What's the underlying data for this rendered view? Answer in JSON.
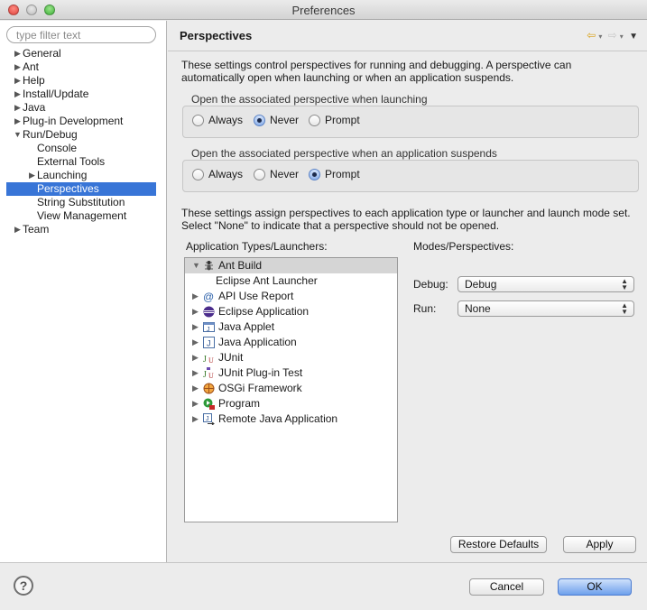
{
  "window": {
    "title": "Preferences"
  },
  "filter": {
    "placeholder": "type filter text"
  },
  "tree": {
    "items": [
      {
        "label": "General"
      },
      {
        "label": "Ant"
      },
      {
        "label": "Help"
      },
      {
        "label": "Install/Update"
      },
      {
        "label": "Java"
      },
      {
        "label": "Plug-in Development"
      },
      {
        "label": "Run/Debug"
      },
      {
        "label": "Console"
      },
      {
        "label": "External Tools"
      },
      {
        "label": "Launching"
      },
      {
        "label": "Perspectives"
      },
      {
        "label": "String Substitution"
      },
      {
        "label": "View Management"
      },
      {
        "label": "Team"
      }
    ]
  },
  "page": {
    "title": "Perspectives",
    "description_line1": "These settings control perspectives for running and debugging. A perspective can",
    "description_line2": "automatically open when launching or when an application suspends.",
    "launch_group": {
      "label": "Open the associated perspective when launching",
      "options": [
        "Always",
        "Never",
        "Prompt"
      ],
      "selected": "Never"
    },
    "suspend_group": {
      "label": "Open the associated perspective when an application suspends",
      "options": [
        "Always",
        "Never",
        "Prompt"
      ],
      "selected": "Prompt"
    },
    "assign_line1": "These settings assign perspectives to each application type or launcher and launch mode set.",
    "assign_line2": "Select \"None\" to indicate that a perspective should not be opened.",
    "types_label": "Application Types/Launchers:",
    "modes_label": "Modes/Perspectives:",
    "types": [
      "Ant Build",
      "Eclipse Ant Launcher",
      "API Use Report",
      "Eclipse Application",
      "Java Applet",
      "Java Application",
      "JUnit",
      "JUnit Plug-in Test",
      "OSGi Framework",
      "Program",
      "Remote Java Application"
    ],
    "debug_label": "Debug:",
    "debug_value": "Debug",
    "run_label": "Run:",
    "run_value": "None",
    "restore_defaults": "Restore Defaults",
    "apply": "Apply"
  },
  "footer": {
    "cancel": "Cancel",
    "ok": "OK",
    "help_glyph": "?"
  },
  "colors": {
    "selection": "#3875d7",
    "default_button": "#6ea0ec"
  }
}
